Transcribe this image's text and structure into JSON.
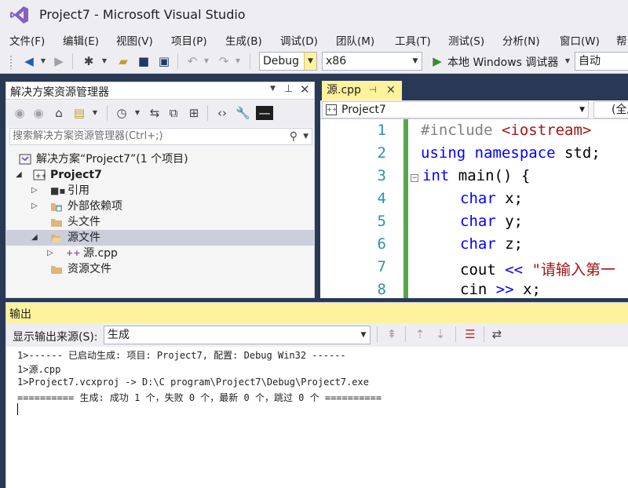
{
  "window": {
    "title": "Project7 - Microsoft Visual Studio"
  },
  "menu": [
    "文件(F)",
    "编辑(E)",
    "视图(V)",
    "项目(P)",
    "生成(B)",
    "调试(D)",
    "团队(M)",
    "工具(T)",
    "测试(S)",
    "分析(N)",
    "窗口(W)",
    "帮"
  ],
  "toolbar": {
    "config": "Debug",
    "platform": "x86",
    "debugger": "本地 Windows 调试器",
    "auto": "自动"
  },
  "solution_explorer": {
    "title": "解决方案资源管理器",
    "search_placeholder": "搜索解决方案资源管理器(Ctrl+;)",
    "items": [
      {
        "label": "解决方案“Project7”(1 个项目)"
      },
      {
        "label": "Project7"
      },
      {
        "label": "引用"
      },
      {
        "label": "外部依赖项"
      },
      {
        "label": "头文件"
      },
      {
        "label": "源文件"
      },
      {
        "label": "源.cpp"
      },
      {
        "label": "资源文件"
      }
    ]
  },
  "editor": {
    "tab": "源.cpp",
    "nav_left": "Project7",
    "nav_right": "(全局",
    "line_numbers": [
      "1",
      "2",
      "3",
      "4",
      "5",
      "6",
      "7",
      "8"
    ],
    "lines": {
      "l1a": "#include ",
      "l1b": "<iostream>",
      "l2a": "using",
      "l2b": " ",
      "l2c": "namespace",
      "l2d": " std;",
      "l3a": "int",
      "l3b": " main() {",
      "l4a": "char",
      "l4b": " x;",
      "l5a": "char",
      "l5b": " y;",
      "l6a": "char",
      "l6b": " z;",
      "l7a": "cout ",
      "l7b": "<<",
      "l7c": " \"请输入第一",
      "l8a": "cin ",
      "l8b": ">>",
      "l8c": " x;"
    }
  },
  "output": {
    "title": "输出",
    "source_label": "显示输出来源(S):",
    "source_value": "生成",
    "lines": [
      "1>------ 已启动生成: 项目: Project7, 配置: Debug Win32 ------",
      "1>源.cpp",
      "1>Project7.vcxproj -> D:\\C program\\Project7\\Debug\\Project7.exe",
      "========== 生成: 成功 1 个，失败 0 个，最新 0 个，跳过 0 个 =========="
    ]
  }
}
